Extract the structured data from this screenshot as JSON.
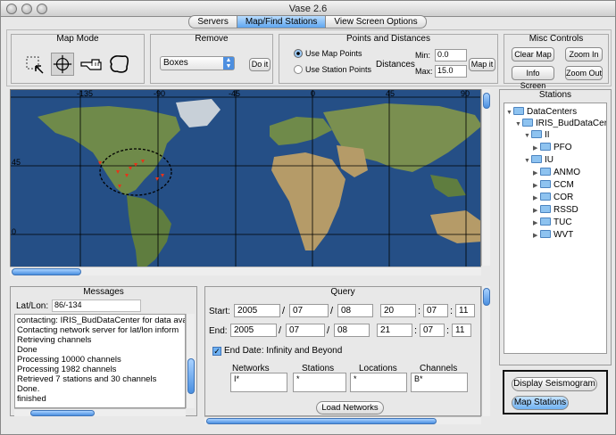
{
  "window": {
    "title": "Vase 2.6"
  },
  "tabs": [
    {
      "label": "Servers",
      "active": false
    },
    {
      "label": "Map/Find Stations",
      "active": true
    },
    {
      "label": "View Screen Options",
      "active": false
    }
  ],
  "map_mode": {
    "title": "Map Mode",
    "tools": [
      "select-box-icon",
      "crosshair-icon",
      "pointing-hand-icon",
      "lasso-icon"
    ]
  },
  "remove": {
    "title": "Remove",
    "select_value": "Boxes",
    "do_it_label": "Do it"
  },
  "points": {
    "title": "Points and Distances",
    "radio_map": "Use Map Points",
    "radio_station": "Use Station Points",
    "distances_label": "Distances",
    "min_label": "Min:",
    "min_value": "0.0",
    "max_label": "Max:",
    "max_value": "15.0",
    "map_it_label": "Map it"
  },
  "misc": {
    "title": "Misc Controls",
    "clear_map": "Clear Map",
    "zoom_in": "Zoom In",
    "info_screen": "Info Screen",
    "zoom_out": "Zoom Out"
  },
  "map": {
    "lon_labels": [
      "-135",
      "-90",
      "-45",
      "0",
      "45",
      "90"
    ],
    "lat_labels": [
      "45",
      "0"
    ],
    "colors": {
      "ocean": "#254f86",
      "land": "#6f8a4a",
      "desert": "#b59b68",
      "station": "#e8331a"
    }
  },
  "messages": {
    "title": "Messages",
    "latlon_label": "Lat/Lon:",
    "latlon_value": "86/-134",
    "lines": [
      "contacting: IRIS_BudDataCenter  for data ava",
      "Contacting network server for lat/lon inform",
      "Retrieving channels",
      "Done",
      "Processing 10000 channels",
      "Processing 1982 channels",
      "Retrieved 7  stations and 30 channels",
      "Done.",
      "finished"
    ]
  },
  "query": {
    "title": "Query",
    "start_label": "Start:",
    "start": [
      "2005",
      "07",
      "08",
      "20",
      "07",
      "11"
    ],
    "end_label": "End:",
    "end": [
      "2005",
      "07",
      "08",
      "21",
      "07",
      "11"
    ],
    "slash": "/",
    "colon": ":",
    "end_date_label": "End Date: Infinity and Beyond",
    "col_networks": "Networks",
    "col_stations": "Stations",
    "col_locations": "Locations",
    "col_channels": "Channels",
    "networks_value": "I*",
    "stations_value": "*",
    "locations_value": "*",
    "channels_value": "B*",
    "load_label": "Load Networks"
  },
  "stations": {
    "title": "Stations",
    "root": "DataCenters",
    "center": "IRIS_BudDataCer",
    "net_ii": "II",
    "net_iu": "IU",
    "ii_stations": [
      "PFO"
    ],
    "iu_stations": [
      "ANMO",
      "CCM",
      "COR",
      "RSSD",
      "TUC",
      "WVT"
    ],
    "display_seismogram": "Display Seismogram",
    "map_stations": "Map Stations"
  }
}
